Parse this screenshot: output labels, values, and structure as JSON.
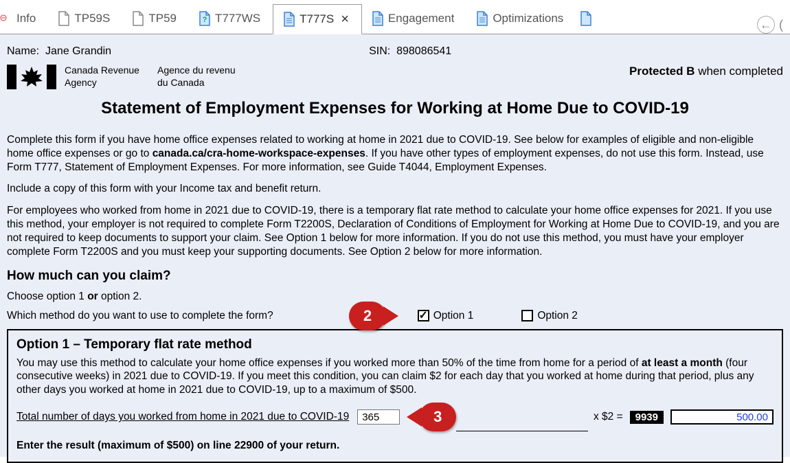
{
  "tabs": {
    "t0": "Info",
    "t1": "TP59S",
    "t2": "TP59",
    "t3": "T777WS",
    "t4": "T777S",
    "t5": "Engagement",
    "t6": "Optimizations"
  },
  "header": {
    "name_label": "Name:",
    "name_value": "Jane Grandin",
    "sin_label": "SIN:",
    "sin_value": "898086541",
    "agency_en_1": "Canada Revenue",
    "agency_en_2": "Agency",
    "agency_fr_1": "Agence du revenu",
    "agency_fr_2": "du Canada",
    "protected_bold": "Protected B",
    "protected_rest": " when completed"
  },
  "title": "Statement of Employment Expenses for Working at Home Due to COVID-19",
  "para1_a": "Complete this form if you have home office expenses related to working at home in 2021 due to COVID-19. See below for examples of eligible and non-eligible home office expenses or go to ",
  "para1_bold": "canada.ca/cra-home-workspace-expenses",
  "para1_b": ". If you have other types of employment expenses, do not use this form. Instead, use Form T777, Statement of Employment Expenses. For more information, see Guide T4044, Employment Expenses.",
  "para2": "Include a copy of this form with your Income tax and benefit return.",
  "para3": "For employees who worked from home in 2021 due to COVID-19, there is a temporary flat rate method to calculate your home office expenses for 2021. If you use this method, your employer is not required to complete Form T2200S, Declaration of Conditions of Employment for Working at Home Due to COVID-19, and you are not required to keep documents to support your claim. See Option 1 below for more information. If you do not use this method, you must have your employer complete Form T2200S and you must keep your supporting documents. See Option 2 below for more information.",
  "subhead": "How much can you claim?",
  "choose_a": "Choose option 1 ",
  "choose_bold": "or",
  "choose_b": " option 2.",
  "method_q": "Which method do you want to use to complete the form?",
  "opt1_label": "Option 1",
  "opt2_label": "Option 2",
  "callout2": "2",
  "callout3": "3",
  "option1": {
    "heading": "Option 1 – Temporary flat rate method",
    "p_a": "You may use this method to calculate your home office expenses if you worked more than 50% of the time from home for a period of ",
    "p_bold": "at least a month",
    "p_b": " (four consecutive weeks) in 2021 due to COVID-19. If you meet this condition, you can claim $2 for each day that you worked at home during that period, plus any other days you worked at home in 2021 due to COVID-19, up to a maximum of $500.",
    "calc_label": "Total number of days you worked from home in 2021 due to COVID-19",
    "days_value": "365",
    "multiplier": "x   $2   =",
    "line_no": "9939",
    "amount": "500.00",
    "enter_result": "Enter the result (maximum of $500) on line 22900 of your return."
  }
}
